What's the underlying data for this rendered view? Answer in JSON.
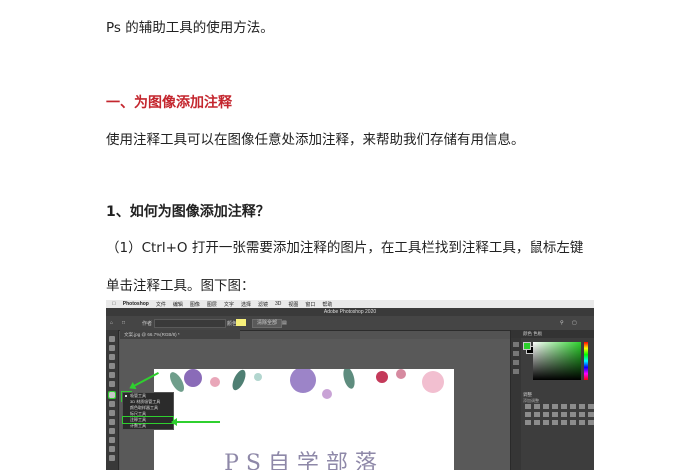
{
  "document": {
    "intro": "Ps 的辅助工具的使用方法。",
    "section_heading": "一、为图像添加注释",
    "section_desc": "使用注释工具可以在图像任意处添加注释，来帮助我们存储有用信息。",
    "subheading": "1、如何为图像添加注释？",
    "step_line1": "（1）Ctrl+O 打开一张需要添加注释的图片，在工具栏找到注释工具，鼠标左键",
    "step_line2": "单击注释工具。图下图："
  },
  "screenshot": {
    "menubar": {
      "app": "Photoshop",
      "items": [
        "文件",
        "编辑",
        "图像",
        "图层",
        "文字",
        "选择",
        "滤镜",
        "3D",
        "视图",
        "窗口",
        "帮助"
      ]
    },
    "window_title": "Adobe Photoshop 2020",
    "options": {
      "author_label": "作者",
      "color_label": "颜色:",
      "clear_all": "清除全部"
    },
    "doc_tab": "文案.jpg @ 66.7%(RGB/8) *",
    "tool_flyout": {
      "items": [
        "吸管工具",
        "3D 材质吸管工具",
        "颜色取样器工具",
        "标尺工具",
        "注释工具",
        "计数工具"
      ],
      "selected_index": 4
    },
    "canvas_title": "PS自学部落",
    "panel": {
      "tabs": "颜色  色板",
      "section_label": "调整",
      "sub_label": "添加调整"
    },
    "colors": {
      "highlight": "#2fd02f",
      "heading_red": "#c4262e",
      "note_color": "#f7f07a"
    }
  }
}
